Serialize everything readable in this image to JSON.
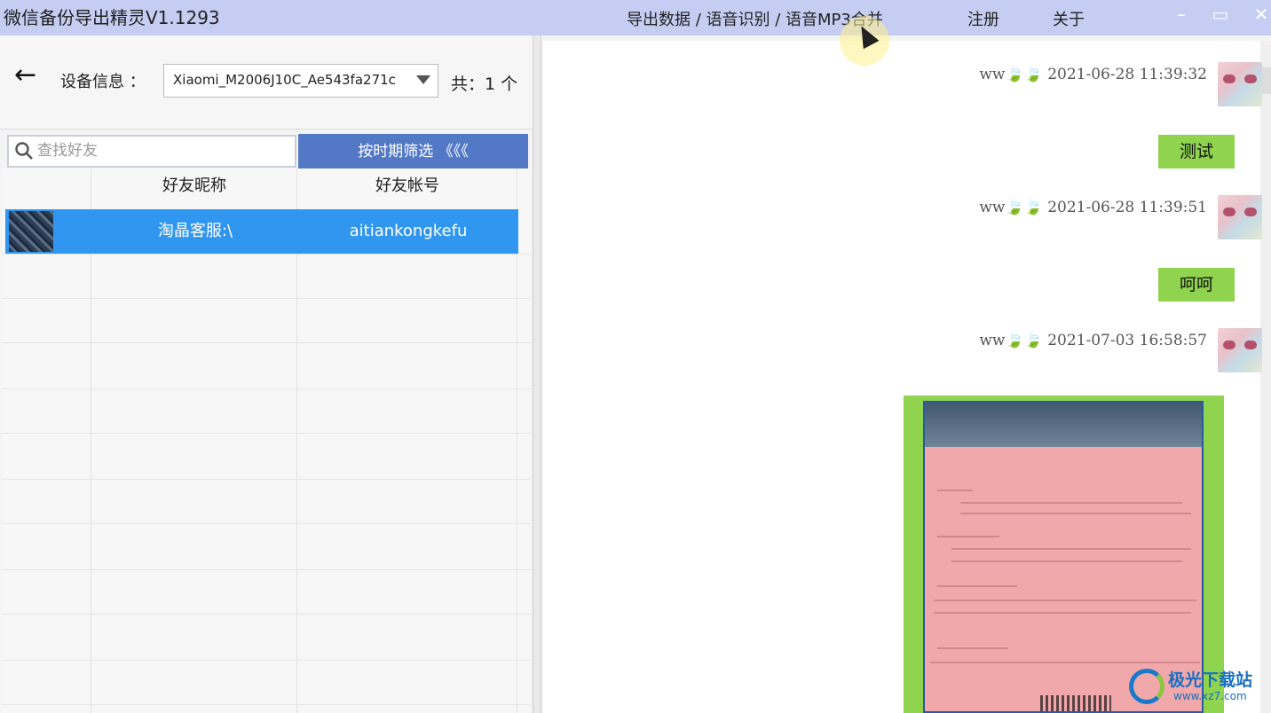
{
  "window": {
    "title": "微信备份导出精灵V1.1293",
    "menu": [
      "导出数据 / 语音识别 / 语音MP3合并",
      "注册",
      "关于"
    ],
    "controls": [
      "–",
      "▭",
      "✕"
    ]
  },
  "device": {
    "back_icon": "←",
    "label": "设备信息 ：",
    "selected": "Xiaomi_M2006J10C_Ae543fa271c",
    "count_label": "共：1 个"
  },
  "search": {
    "placeholder": "查找好友"
  },
  "filter_button": "按时期筛选 《《《",
  "table": {
    "headers": [
      "",
      "好友昵称",
      "好友帐号"
    ],
    "rows": [
      {
        "nickname": "淘晶客服:\\",
        "account": "aitiankongkefu"
      }
    ]
  },
  "chat": {
    "messages": [
      {
        "sender": "ww🍃🍃",
        "time": "2021-06-28 11:39:32",
        "text": "测试"
      },
      {
        "sender": "ww🍃🍃",
        "time": "2021-06-28 11:39:51",
        "text": "呵呵"
      },
      {
        "sender": "ww🍃🍃",
        "time": "2021-07-03 16:58:57",
        "text": ""
      }
    ]
  },
  "watermark": {
    "name": "极光下载站",
    "url": "www.xz7.com"
  },
  "colors": {
    "titlebar": "#c5cdf2",
    "accent": "#3196ef",
    "filter": "#5379c6",
    "bubble": "#8fd34f"
  }
}
